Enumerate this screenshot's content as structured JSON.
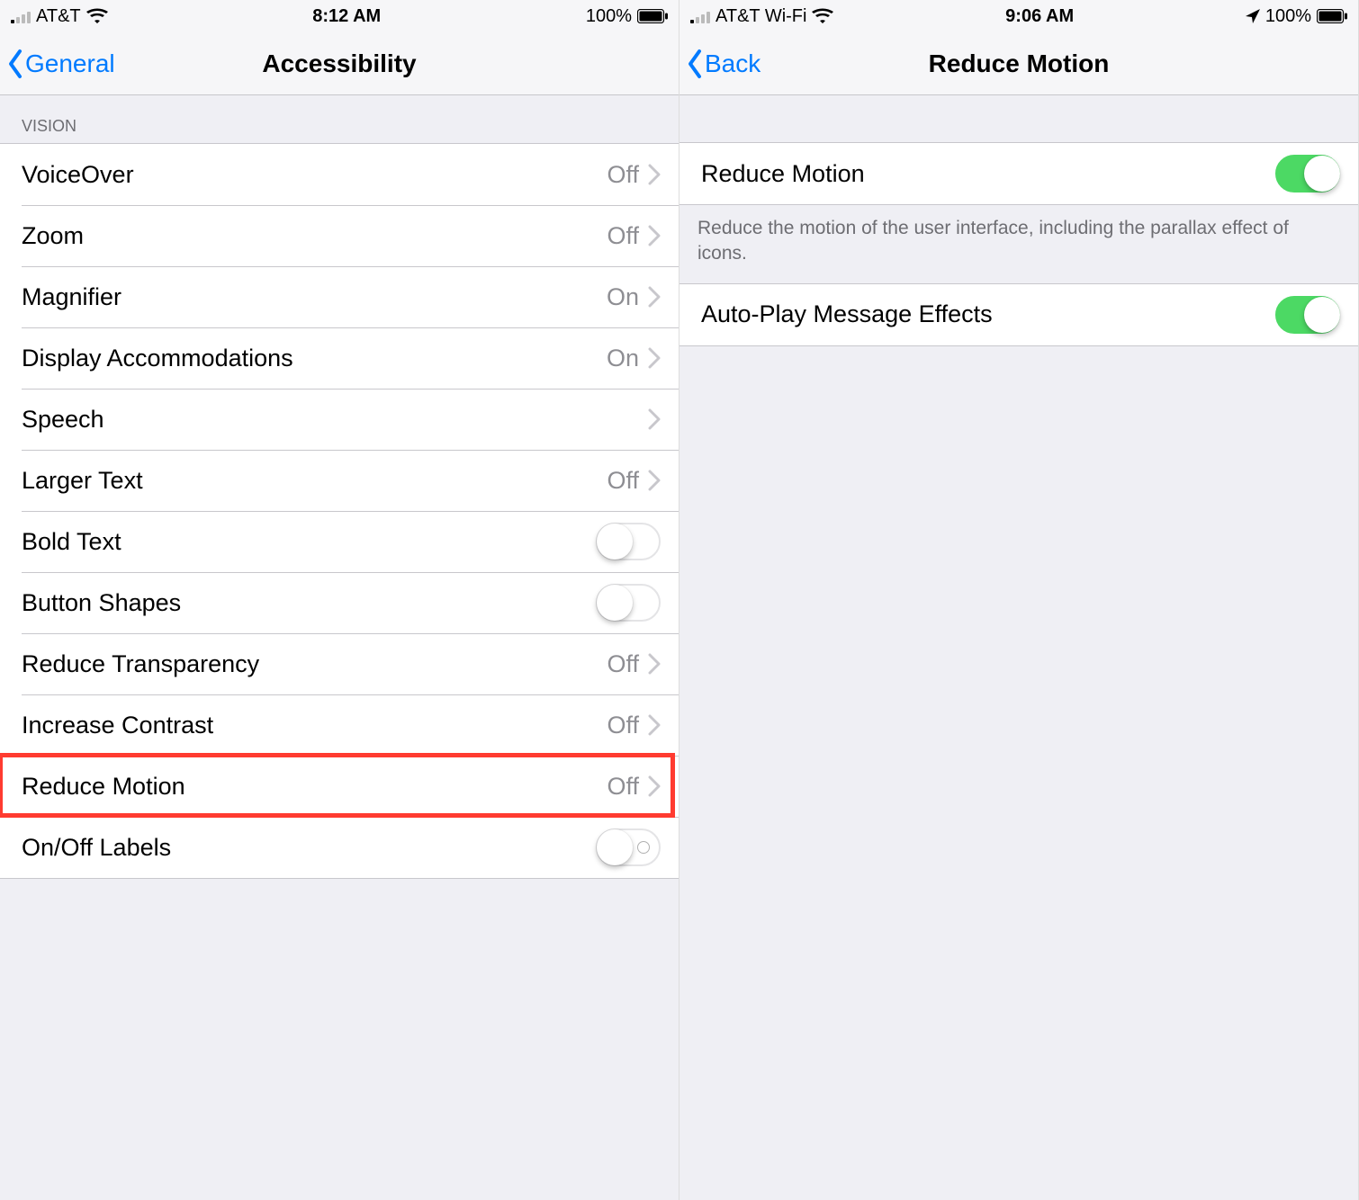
{
  "left": {
    "status": {
      "carrier": "AT&T",
      "time": "8:12 AM",
      "battery_text": "100%",
      "has_location": false
    },
    "nav": {
      "back": "General",
      "title": "Accessibility"
    },
    "header": "Vision",
    "rows": [
      {
        "label": "VoiceOver",
        "kind": "disclose",
        "value": "Off"
      },
      {
        "label": "Zoom",
        "kind": "disclose",
        "value": "Off"
      },
      {
        "label": "Magnifier",
        "kind": "disclose",
        "value": "On"
      },
      {
        "label": "Display Accommodations",
        "kind": "disclose",
        "value": "On"
      },
      {
        "label": "Speech",
        "kind": "disclose",
        "value": ""
      },
      {
        "label": "Larger Text",
        "kind": "disclose",
        "value": "Off"
      },
      {
        "label": "Bold Text",
        "kind": "switch",
        "on": false
      },
      {
        "label": "Button Shapes",
        "kind": "switch",
        "on": false
      },
      {
        "label": "Reduce Transparency",
        "kind": "disclose",
        "value": "Off"
      },
      {
        "label": "Increase Contrast",
        "kind": "disclose",
        "value": "Off"
      },
      {
        "label": "Reduce Motion",
        "kind": "disclose",
        "value": "Off",
        "highlight": true
      },
      {
        "label": "On/Off Labels",
        "kind": "switch",
        "on": false,
        "labels": true
      }
    ]
  },
  "right": {
    "status": {
      "carrier": "AT&T Wi-Fi",
      "time": "9:06 AM",
      "battery_text": "100%",
      "has_location": true
    },
    "nav": {
      "back": "Back",
      "title": "Reduce Motion"
    },
    "groups": [
      {
        "rows": [
          {
            "label": "Reduce Motion",
            "kind": "switch",
            "on": true
          }
        ],
        "footer": "Reduce the motion of the user interface, including the parallax effect of icons."
      },
      {
        "rows": [
          {
            "label": "Auto-Play Message Effects",
            "kind": "switch",
            "on": true
          }
        ]
      }
    ]
  },
  "colors": {
    "accent": "#007aff",
    "green": "#4cd964",
    "highlight": "#ff3b30"
  }
}
